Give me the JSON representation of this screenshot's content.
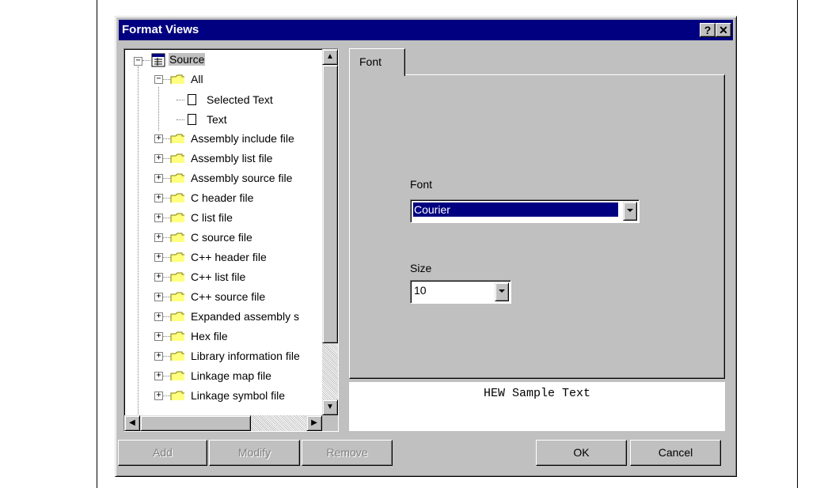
{
  "dialog": {
    "title": "Format Views",
    "help_glyph": "?",
    "close_glyph": "✕"
  },
  "tree": {
    "items": [
      {
        "label": "Source",
        "icon": "source-icon"
      },
      {
        "label": "All",
        "icon": "folder-icon"
      },
      {
        "label": "Selected Text",
        "icon": "document-icon"
      },
      {
        "label": "Text",
        "icon": "document-icon"
      },
      {
        "label": "Assembly include file",
        "icon": "folder-icon"
      },
      {
        "label": "Assembly list file",
        "icon": "folder-icon"
      },
      {
        "label": "Assembly source file",
        "icon": "folder-icon"
      },
      {
        "label": "C header file",
        "icon": "folder-icon"
      },
      {
        "label": "C list file",
        "icon": "folder-icon"
      },
      {
        "label": "C source file",
        "icon": "folder-icon"
      },
      {
        "label": "C++ header file",
        "icon": "folder-icon"
      },
      {
        "label": "C++ list file",
        "icon": "folder-icon"
      },
      {
        "label": "C++ source file",
        "icon": "folder-icon"
      },
      {
        "label": "Expanded assembly s",
        "icon": "folder-icon"
      },
      {
        "label": "Hex file",
        "icon": "folder-icon"
      },
      {
        "label": "Library information file",
        "icon": "folder-icon"
      },
      {
        "label": "Linkage map file",
        "icon": "folder-icon"
      },
      {
        "label": "Linkage symbol file",
        "icon": "folder-icon"
      }
    ],
    "expanders": {
      "collapse": "−",
      "expand": "+"
    },
    "scroll_glyphs": {
      "up": "▲",
      "down": "▼",
      "left": "◀",
      "right": "▶"
    }
  },
  "tabs": [
    {
      "label": "Font"
    }
  ],
  "font_panel": {
    "font_label": "Font",
    "font_value": "Courier",
    "size_label": "Size",
    "size_value": "10"
  },
  "sample_text": "HEW Sample Text",
  "buttons": {
    "add": "Add",
    "modify": "Modify",
    "remove": "Remove",
    "ok": "OK",
    "cancel": "Cancel"
  },
  "colors": {
    "titlebar": "#000080",
    "face": "#c0c0c0",
    "selection": "#000080"
  }
}
